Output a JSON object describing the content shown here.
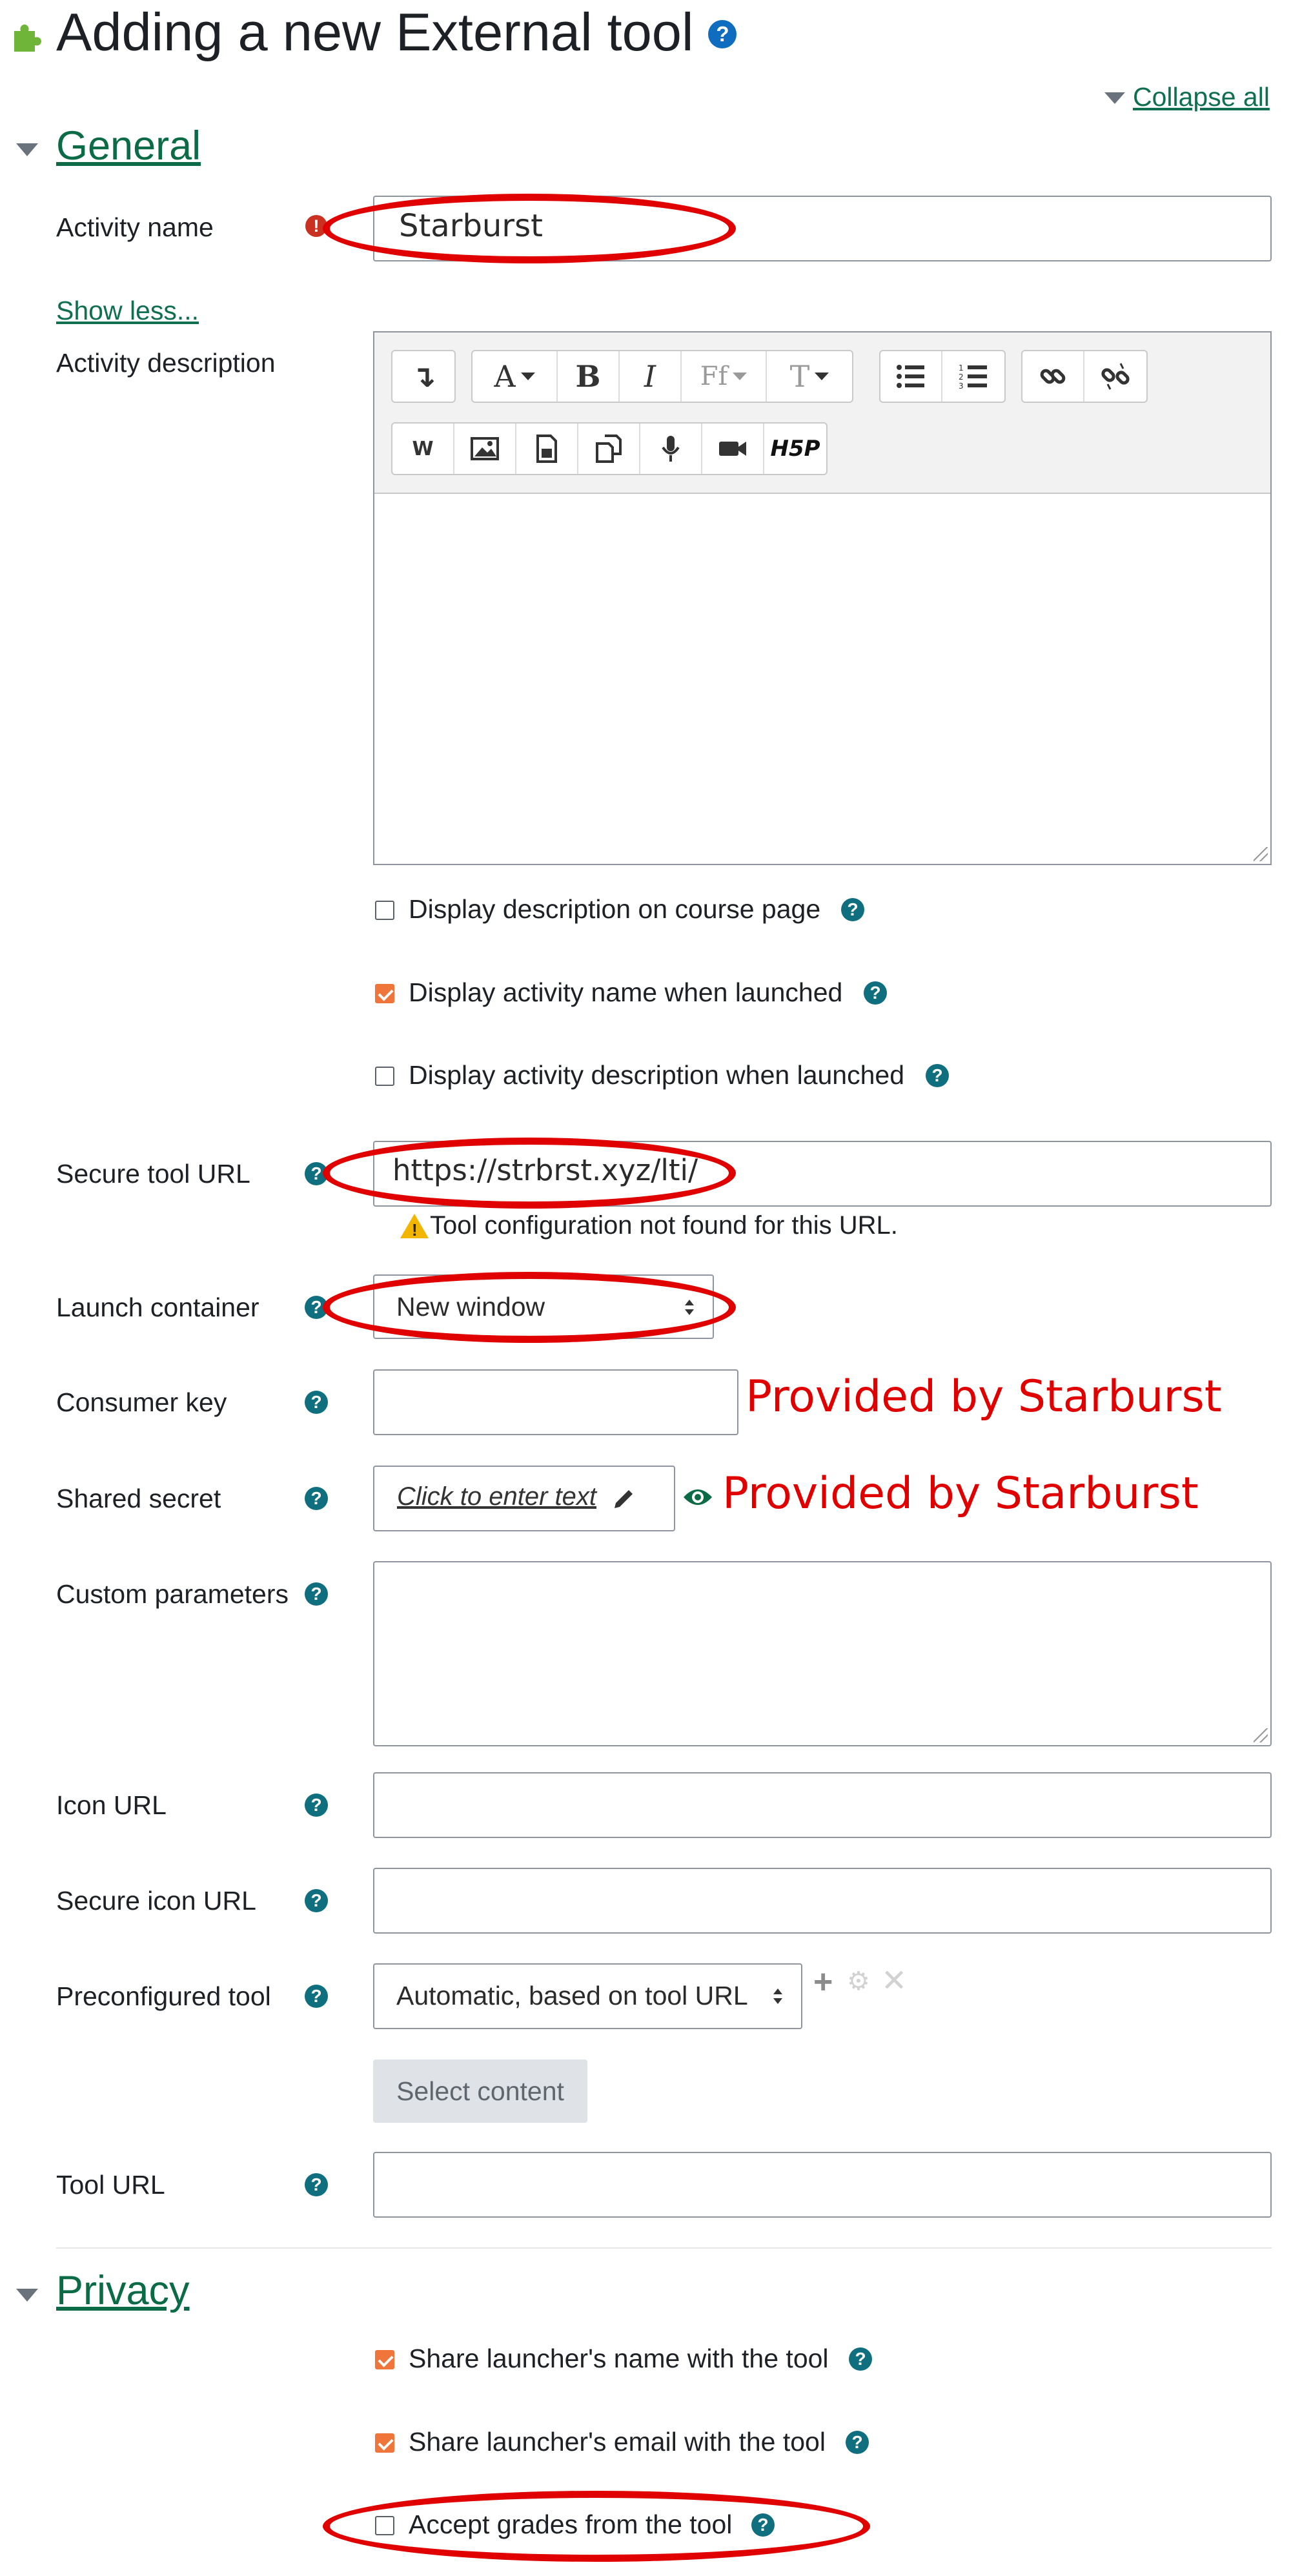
{
  "page": {
    "title": "Adding a new External tool",
    "collapse_all": "Collapse all"
  },
  "general": {
    "heading": "General",
    "activity_name_label": "Activity name",
    "activity_name_value": "Starburst",
    "show_less": "Show less...",
    "activity_description_label": "Activity description",
    "options": [
      {
        "label": "Display description on course page",
        "checked": false
      },
      {
        "label": "Display activity name when launched",
        "checked": true
      },
      {
        "label": "Display activity description when launched",
        "checked": false
      }
    ],
    "secure_tool_url_label": "Secure tool URL",
    "secure_tool_url_value": "https://strbrst.xyz/lti/",
    "tool_config_warning": "Tool configuration not found for this URL.",
    "launch_container_label": "Launch container",
    "launch_container_value": "New window",
    "consumer_key_label": "Consumer key",
    "consumer_key_value": "",
    "consumer_key_note": "Provided by Starburst",
    "shared_secret_label": "Shared secret",
    "shared_secret_placeholder": "Click to enter text",
    "shared_secret_note": "Provided by Starburst",
    "custom_parameters_label": "Custom parameters",
    "icon_url_label": "Icon URL",
    "secure_icon_url_label": "Secure icon URL",
    "preconfigured_tool_label": "Preconfigured tool",
    "preconfigured_tool_value": "Automatic, based on tool URL",
    "select_content_button": "Select content",
    "tool_url_label": "Tool URL"
  },
  "editor_toolbar": {
    "row1": [
      "collapse-icon",
      "font-color-icon",
      "bold-icon",
      "italic-icon",
      "font-family-icon",
      "font-size-icon",
      "bullet-list-icon",
      "numbered-list-icon",
      "link-icon",
      "unlink-icon"
    ],
    "row2": [
      "word-paste-icon",
      "image-icon",
      "media-icon",
      "manage-files-icon",
      "record-audio-icon",
      "record-video-icon",
      "h5p-icon"
    ],
    "h5p_text": "H5P"
  },
  "privacy": {
    "heading": "Privacy",
    "options": [
      {
        "label": "Share launcher's name with the tool",
        "checked": true
      },
      {
        "label": "Share launcher's email with the tool",
        "checked": true
      },
      {
        "label": "Accept grades from the tool",
        "checked": false
      }
    ]
  },
  "colors": {
    "link_green": "#0b6b46",
    "help_teal": "#0f6f7f",
    "checkbox_orange": "#f0753a",
    "annotation_red": "#e00000",
    "error_red": "#ca3120"
  }
}
